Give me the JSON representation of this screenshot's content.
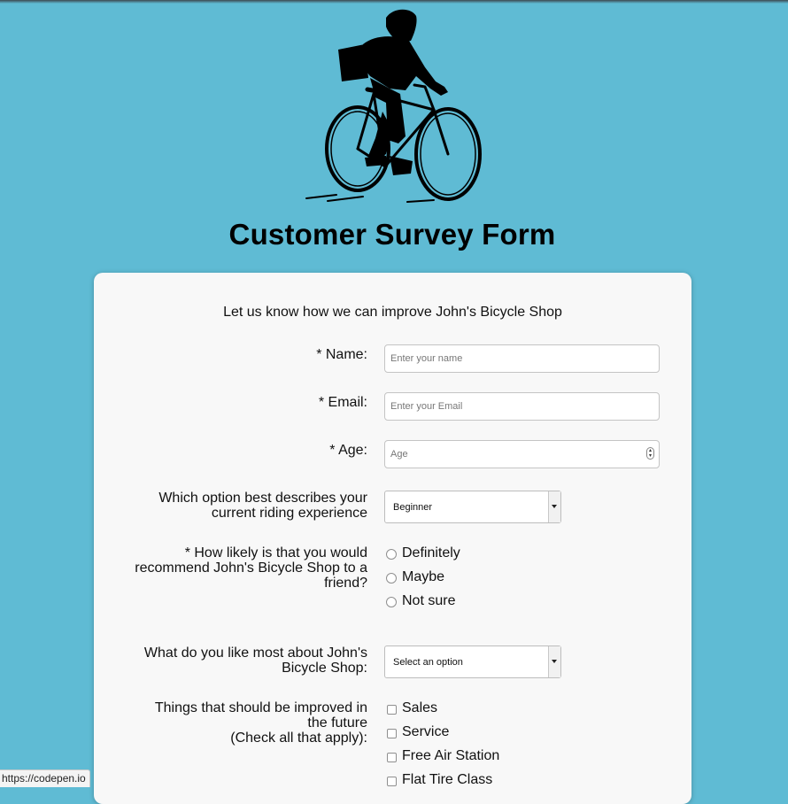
{
  "page": {
    "title": "Customer Survey Form",
    "intro": "Let us know how we can improve John's Bicycle Shop"
  },
  "logo": {
    "icon": "cyclist-icon"
  },
  "fields": {
    "name_label": "* Name:",
    "name_placeholder": "Enter your name",
    "email_label": "* Email:",
    "email_placeholder": "Enter your Email",
    "age_label": "* Age:",
    "age_placeholder": "Age",
    "experience_label_1": "Which option best describes your",
    "experience_label_2": "current riding experience",
    "experience_value": "Beginner",
    "recommend_label_1": "* How likely is that you would",
    "recommend_label_2": "recommend John's Bicycle Shop to a",
    "recommend_label_3": "friend?",
    "recommend_options": [
      "Definitely",
      "Maybe",
      "Not sure"
    ],
    "like_label_1": "What do you like most about John's",
    "like_label_2": "Bicycle Shop:",
    "like_value": "Select an option",
    "improve_label_1": "Things that should be improved in",
    "improve_label_2": "the future",
    "improve_label_3": "(Check all that apply):",
    "improve_options": [
      "Sales",
      "Service",
      "Free Air Station",
      "Flat Tire Class"
    ]
  },
  "status_bar": {
    "url": "https://codepen.io"
  },
  "colors": {
    "background": "#5fbbd4",
    "card": "#f8f8f8"
  }
}
